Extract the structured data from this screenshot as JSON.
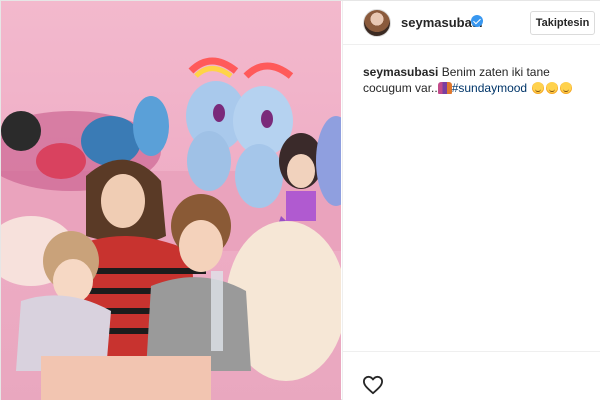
{
  "post": {
    "photo": {
      "description_icon": "photo-content"
    },
    "header": {
      "username": "seymasubasi",
      "verified_icon": "verified-badge-icon",
      "follow_label": "Takiptesin"
    },
    "caption": {
      "username": "seymasubasi",
      "text": "Benim zaten iki tane cocugum var..",
      "hashtag": "#sundaymood"
    },
    "actions": {
      "like_icon": "heart-icon"
    },
    "colors": {
      "accent_blue": "#3897f0",
      "hashtag": "#003569",
      "photo_bg": "#efaec6"
    }
  }
}
